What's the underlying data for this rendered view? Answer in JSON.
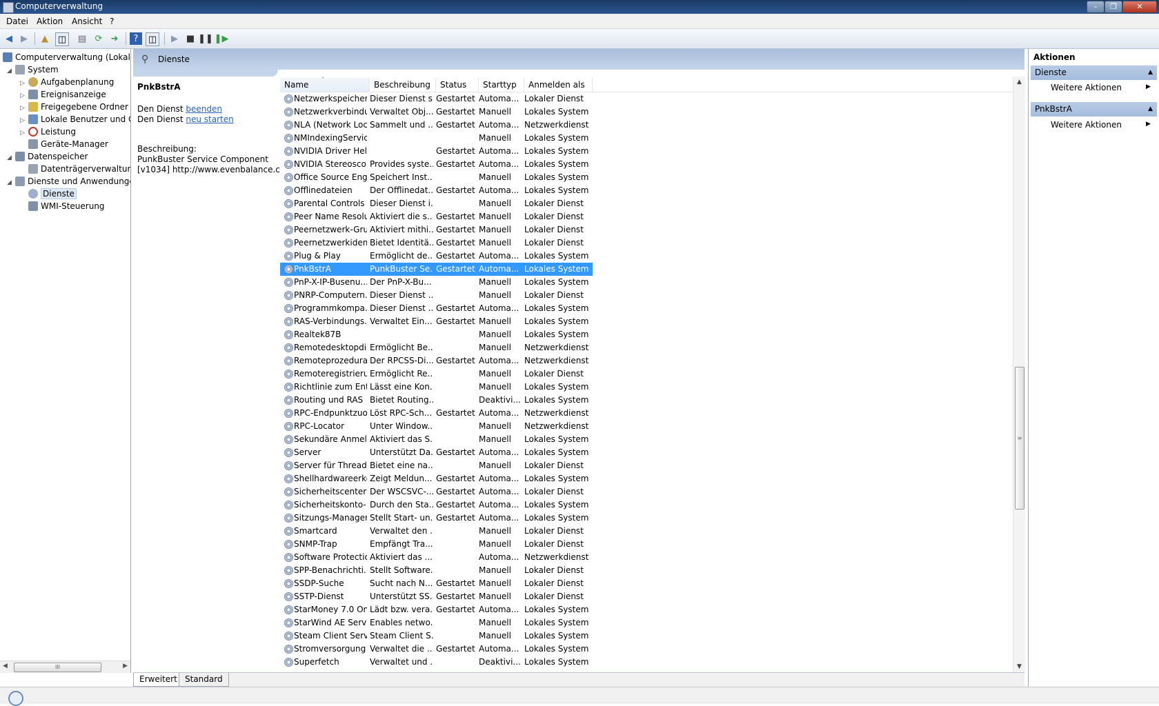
{
  "window": {
    "title": "Computerverwaltung"
  },
  "menu": [
    "Datei",
    "Aktion",
    "Ansicht",
    "?"
  ],
  "tree": [
    {
      "label": "Computerverwaltung (Lokal)",
      "icon": "computer-icon",
      "color": "#5b7fb1"
    },
    {
      "label": "System",
      "icon": "system-icon",
      "color": "#9aa4b0"
    },
    {
      "label": "Aufgabenplanung",
      "icon": "clock-icon",
      "color": "#c9a95a"
    },
    {
      "label": "Ereignisanzeige",
      "icon": "event-log-icon",
      "color": "#7e8fa8"
    },
    {
      "label": "Freigegebene Ordner",
      "icon": "shared-folder-icon",
      "color": "#d6b84b"
    },
    {
      "label": "Lokale Benutzer und Gruppen",
      "icon": "users-icon",
      "color": "#6c8fc2"
    },
    {
      "label": "Leistung",
      "icon": "performance-icon",
      "color": "#c0392b"
    },
    {
      "label": "Geräte-Manager",
      "icon": "device-manager-icon",
      "color": "#8b96a6"
    },
    {
      "label": "Datenspeicher",
      "icon": "storage-icon",
      "color": "#7d8ea6"
    },
    {
      "label": "Datenträgerverwaltung",
      "icon": "disk-icon",
      "color": "#9aa4b0"
    },
    {
      "label": "Dienste und Anwendungen",
      "icon": "services-apps-icon",
      "color": "#8c9bb0"
    },
    {
      "label": "Dienste",
      "icon": "services-icon",
      "color": "#9db1cc"
    },
    {
      "label": "WMI-Steuerung",
      "icon": "wmi-icon",
      "color": "#8190a5"
    }
  ],
  "header": {
    "title": "Dienste"
  },
  "description_panel": {
    "service_name": "PnkBstrA",
    "stop_prefix": "Den Dienst",
    "stop_link": "beenden",
    "restart_prefix": "Den Dienst",
    "restart_link": "neu starten",
    "desc_label": "Beschreibung:",
    "desc_line1": "PunkBuster Service Component",
    "desc_line2": "[v1034] http://www.evenbalance.com"
  },
  "columns": [
    "Name",
    "Beschreibung",
    "Status",
    "Starttyp",
    "Anmelden als"
  ],
  "services": [
    [
      "Netzwerkspeicher...",
      "Dieser Dienst s...",
      "Gestartet",
      "Automa...",
      "Lokaler Dienst"
    ],
    [
      "Netzwerkverbindu...",
      "Verwaltet Obj...",
      "Gestartet",
      "Manuell",
      "Lokales System"
    ],
    [
      "NLA (Network Loc...",
      "Sammelt und ...",
      "Gestartet",
      "Automa...",
      "Netzwerkdienst"
    ],
    [
      "NMIndexingService",
      "",
      "",
      "Manuell",
      "Lokales System"
    ],
    [
      "NVIDIA Driver Hel...",
      "",
      "Gestartet",
      "Automa...",
      "Lokales System"
    ],
    [
      "NVIDIA Stereosco...",
      "Provides syste...",
      "Gestartet",
      "Automa...",
      "Lokales System"
    ],
    [
      "Office Source Engi...",
      "Speichert Inst...",
      "",
      "Manuell",
      "Lokales System"
    ],
    [
      "Offlinedateien",
      "Der Offlinedat...",
      "Gestartet",
      "Automa...",
      "Lokales System"
    ],
    [
      "Parental Controls",
      "Dieser Dienst i...",
      "",
      "Manuell",
      "Lokaler Dienst"
    ],
    [
      "Peer Name Resolu...",
      "Aktiviert die s...",
      "Gestartet",
      "Manuell",
      "Lokaler Dienst"
    ],
    [
      "Peernetzwerk-Gru...",
      "Aktiviert mithi...",
      "Gestartet",
      "Manuell",
      "Lokaler Dienst"
    ],
    [
      "Peernetzwerkident...",
      "Bietet Identitä...",
      "Gestartet",
      "Manuell",
      "Lokaler Dienst"
    ],
    [
      "Plug & Play",
      "Ermöglicht de...",
      "Gestartet",
      "Automa...",
      "Lokales System"
    ],
    [
      "PnkBstrA",
      "PunkBuster Se...",
      "Gestartet",
      "Automa...",
      "Lokales System"
    ],
    [
      "PnP-X-IP-Busenu...",
      "Der PnP-X-Bu...",
      "",
      "Manuell",
      "Lokales System"
    ],
    [
      "PNRP-Computern...",
      "Dieser Dienst ...",
      "",
      "Manuell",
      "Lokaler Dienst"
    ],
    [
      "Programmkompa...",
      "Dieser Dienst ...",
      "Gestartet",
      "Automa...",
      "Lokales System"
    ],
    [
      "RAS-Verbindungs...",
      "Verwaltet Ein...",
      "Gestartet",
      "Manuell",
      "Lokales System"
    ],
    [
      "Realtek87B",
      "",
      "",
      "Manuell",
      "Lokales System"
    ],
    [
      "Remotedesktopdi...",
      "Ermöglicht Be...",
      "",
      "Manuell",
      "Netzwerkdienst"
    ],
    [
      "Remoteprozedura...",
      "Der RPCSS-Di...",
      "Gestartet",
      "Automa...",
      "Netzwerkdienst"
    ],
    [
      "Remoteregistrieru...",
      "Ermöglicht Re...",
      "",
      "Manuell",
      "Lokaler Dienst"
    ],
    [
      "Richtlinie zum Ent...",
      "Lässt eine Kon...",
      "",
      "Manuell",
      "Lokales System"
    ],
    [
      "Routing und RAS",
      "Bietet Routing...",
      "",
      "Deaktivi...",
      "Lokales System"
    ],
    [
      "RPC-Endpunktzuo...",
      "Löst RPC-Sch...",
      "Gestartet",
      "Automa...",
      "Netzwerkdienst"
    ],
    [
      "RPC-Locator",
      "Unter Window...",
      "",
      "Manuell",
      "Netzwerkdienst"
    ],
    [
      "Sekundäre Anmel...",
      "Aktiviert das S...",
      "",
      "Manuell",
      "Lokales System"
    ],
    [
      "Server",
      "Unterstützt Da...",
      "Gestartet",
      "Automa...",
      "Lokales System"
    ],
    [
      "Server für Threads...",
      "Bietet eine na...",
      "",
      "Manuell",
      "Lokaler Dienst"
    ],
    [
      "Shellhardwareerke...",
      "Zeigt Meldun...",
      "Gestartet",
      "Automa...",
      "Lokales System"
    ],
    [
      "Sicherheitscenter",
      "Der WSCSVC-...",
      "Gestartet",
      "Automa...",
      "Lokaler Dienst"
    ],
    [
      "Sicherheitskonto-...",
      "Durch den Sta...",
      "Gestartet",
      "Automa...",
      "Lokales System"
    ],
    [
      "Sitzungs-Manager...",
      "Stellt Start- un...",
      "Gestartet",
      "Automa...",
      "Lokales System"
    ],
    [
      "Smartcard",
      "Verwaltet den ...",
      "",
      "Manuell",
      "Lokaler Dienst"
    ],
    [
      "SNMP-Trap",
      "Empfängt Tra...",
      "",
      "Manuell",
      "Lokaler Dienst"
    ],
    [
      "Software Protection",
      "Aktiviert das ...",
      "",
      "Automa...",
      "Netzwerkdienst"
    ],
    [
      "SPP-Benachrichti...",
      "Stellt Software...",
      "",
      "Manuell",
      "Lokaler Dienst"
    ],
    [
      "SSDP-Suche",
      "Sucht nach N...",
      "Gestartet",
      "Manuell",
      "Lokaler Dienst"
    ],
    [
      "SSTP-Dienst",
      "Unterstützt SS...",
      "Gestartet",
      "Manuell",
      "Lokaler Dienst"
    ],
    [
      "StarMoney 7.0 Onl...",
      "Lädt bzw. vera...",
      "Gestartet",
      "Automa...",
      "Lokales System"
    ],
    [
      "StarWind AE Service",
      "Enables netwo...",
      "",
      "Manuell",
      "Lokales System"
    ],
    [
      "Steam Client Servi...",
      "Steam Client S...",
      "",
      "Manuell",
      "Lokales System"
    ],
    [
      "Stromversorgung",
      "Verwaltet die ...",
      "Gestartet",
      "Automa...",
      "Lokales System"
    ],
    [
      "Superfetch",
      "Verwaltet und ...",
      "",
      "Deaktivi...",
      "Lokales System"
    ]
  ],
  "selected_service": "PnkBstrA",
  "tabs": [
    "Erweitert",
    "Standard"
  ],
  "actions": {
    "title": "Aktionen",
    "sections": [
      {
        "title": "Dienste",
        "item": "Weitere Aktionen"
      },
      {
        "title": "PnkBstrA",
        "item": "Weitere Aktionen"
      }
    ]
  },
  "colors": {
    "selection": "#3399ff",
    "header": "#b4c8e3",
    "link": "#2662b8"
  }
}
